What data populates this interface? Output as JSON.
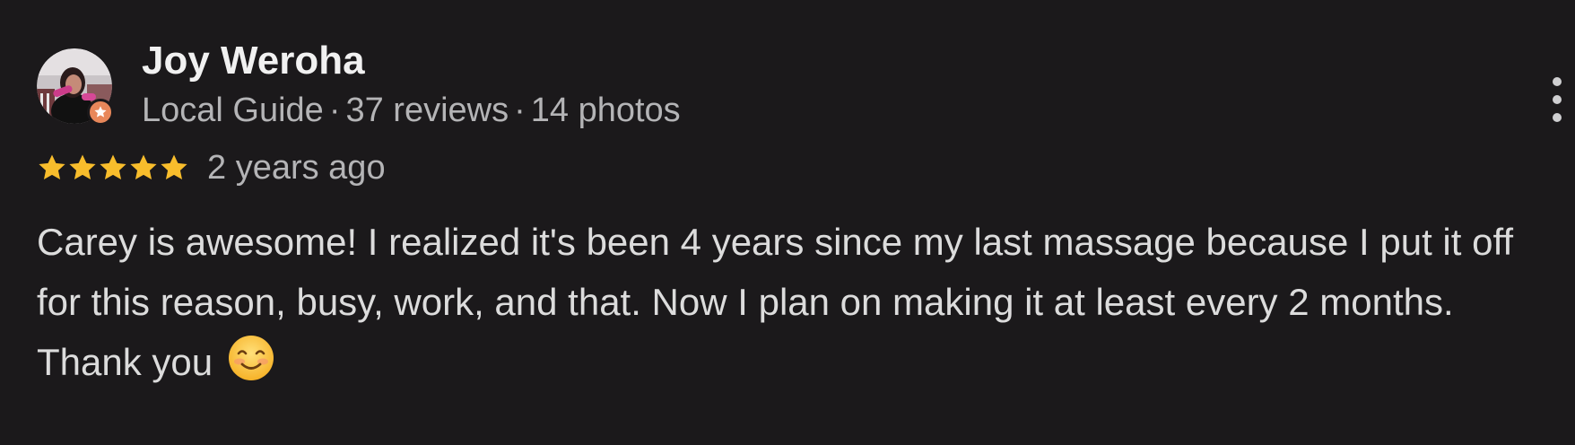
{
  "reviewer": {
    "name": "Joy Weroha",
    "badge": "Local Guide",
    "separator": "·",
    "reviews": "37 reviews",
    "photos": "14 photos"
  },
  "rating": {
    "stars": 5,
    "max": 5,
    "time": "2 years ago",
    "star_color": "#f8bd2c"
  },
  "review": {
    "text": "Carey is awesome! I realized it's been 4 years since my last massage because I put it off for this reason, busy, work, and that. Now I plan on making it at least every 2 months. Thank you",
    "emoji": "smiling-face-icon"
  },
  "icons": {
    "avatar": "avatar-photo",
    "badge": "local-guide-star-icon",
    "more": "more-vert-icon"
  },
  "colors": {
    "background": "#1b191b",
    "badge": "#e8875a",
    "name": "#f1f1f1",
    "meta": "#b4b4b6",
    "text": "#dcdcdc"
  }
}
